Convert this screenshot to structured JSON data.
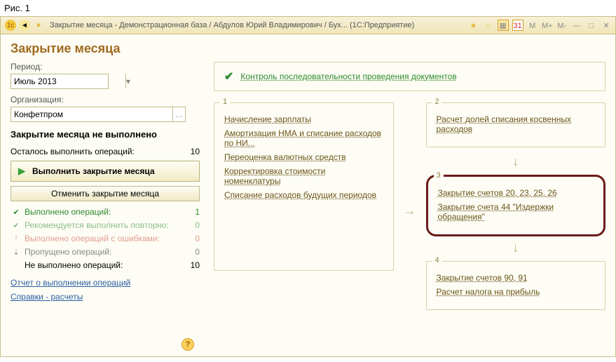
{
  "caption": "Рис. 1",
  "titlebar": {
    "title": "Закрытие месяца - Демонстрационная база / Абдулов Юрий Владимирович / Бух...   (1С:Предприятие)"
  },
  "page": {
    "title": "Закрытие месяца"
  },
  "period": {
    "label": "Период:",
    "value": "Июль 2013"
  },
  "org": {
    "label": "Организация:",
    "value": "Конфетпром"
  },
  "status": {
    "heading": "Закрытие месяца не выполнено"
  },
  "ops_left": {
    "label": "Осталось выполнить операций:",
    "count": "10"
  },
  "buttons": {
    "execute": "Выполнить закрытие месяца",
    "cancel": "Отменить закрытие месяца"
  },
  "stats": {
    "done": {
      "label": "Выполнено операций:",
      "value": "1"
    },
    "retry": {
      "label": "Рекомендуется выполнить повторно:",
      "value": "0"
    },
    "errors": {
      "label": "Выполнено операций с ошибками:",
      "value": "0"
    },
    "skipped": {
      "label": "Пропущено операций:",
      "value": "0"
    },
    "notdone": {
      "label": "Не выполнено операций:",
      "value": "10"
    }
  },
  "links": {
    "report": "Отчет о выполнении операций",
    "refs": "Справки - расчеты"
  },
  "control": {
    "label": "Контроль последовательности проведения документов"
  },
  "step1": {
    "num": "1",
    "items": [
      "Начисление зарплаты",
      "Амортизация НМА и списание расходов по НИ...",
      "Переоценка валютных средств",
      "Корректировка стоимости номенклатуры",
      "Списание расходов будущих периодов"
    ]
  },
  "step2": {
    "num": "2",
    "items": [
      "Расчет долей списания косвенных расходов"
    ]
  },
  "step3": {
    "num": "3",
    "items": [
      "Закрытие счетов 20, 23, 25, 26",
      "Закрытие счета 44 \"Издержки обращения\""
    ]
  },
  "step4": {
    "num": "4",
    "items": [
      "Закрытие счетов 90, 91",
      "Расчет налога на прибыль"
    ]
  }
}
